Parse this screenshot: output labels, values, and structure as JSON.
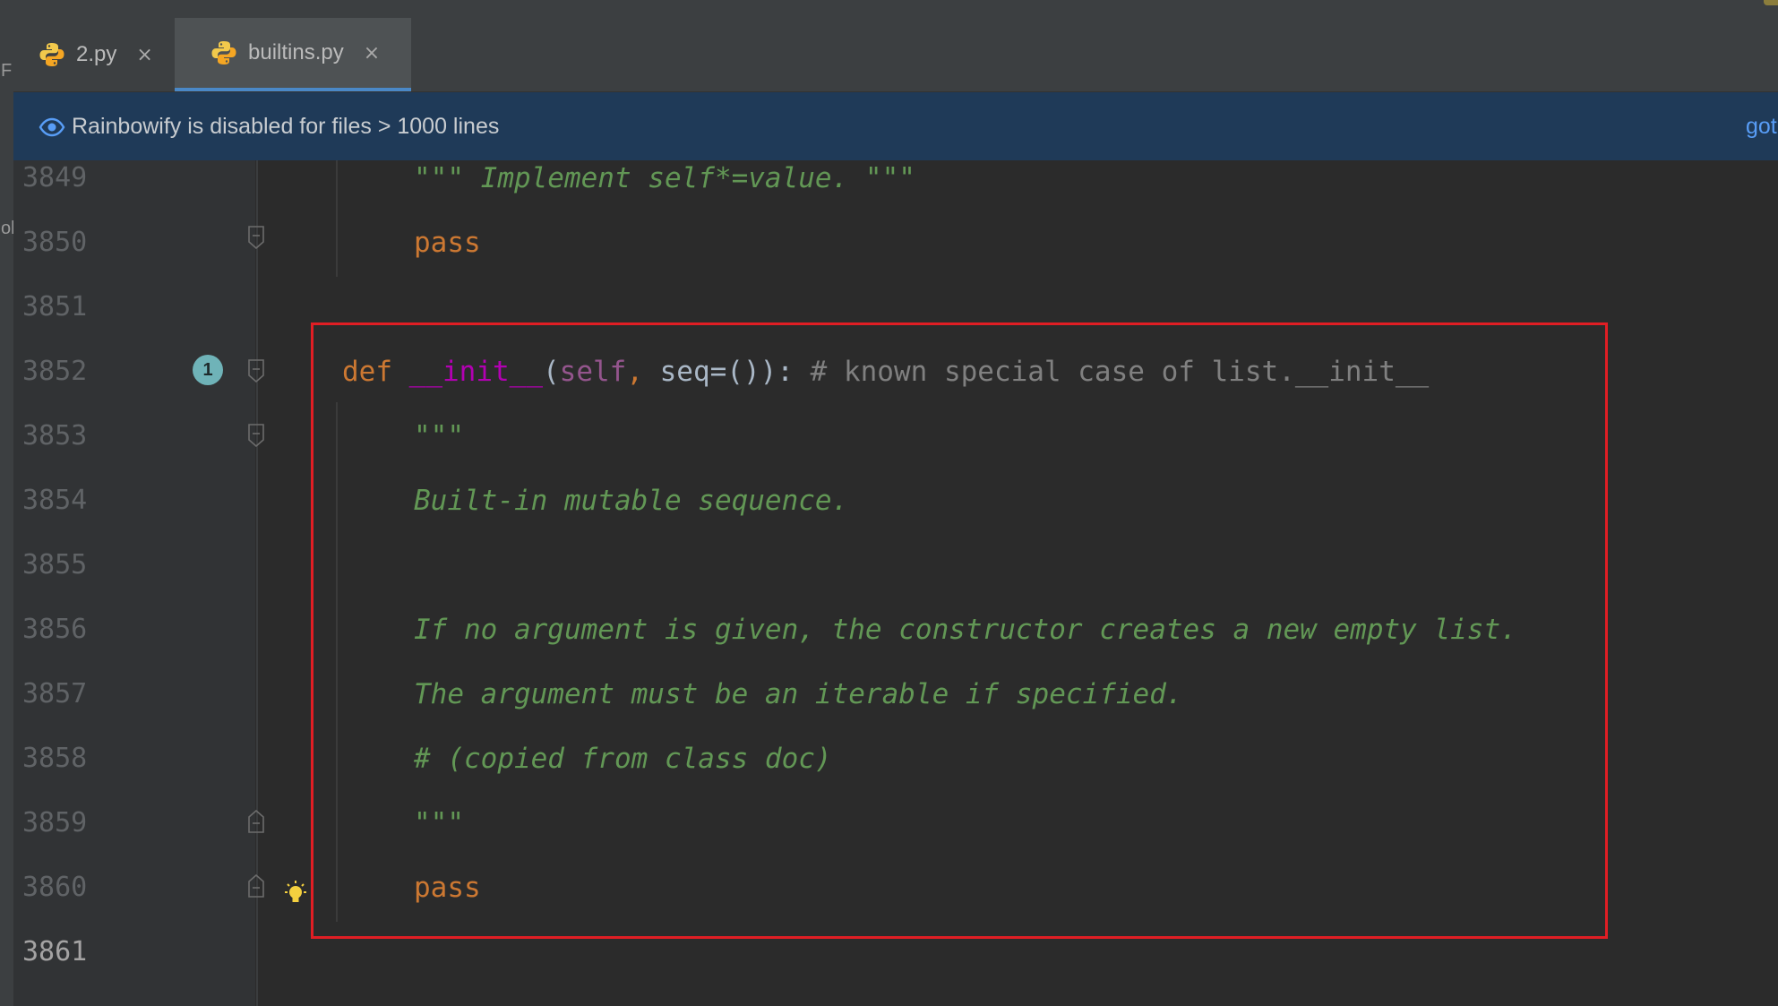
{
  "left_strip": {
    "text_top": "F",
    "text_mid": "ol"
  },
  "tabs": [
    {
      "label": "2.py",
      "icon": "python-icon",
      "active": false,
      "close": "×"
    },
    {
      "label": "builtins.py",
      "icon": "python-icon",
      "active": true,
      "close": "×"
    }
  ],
  "banner": {
    "icon": "eye-icon",
    "text": "Rainbowify is disabled for files > 1000 lines",
    "link": "got"
  },
  "editor": {
    "line_numbers": [
      "3849",
      "3850",
      "3851",
      "3852",
      "3853",
      "3854",
      "3855",
      "3856",
      "3857",
      "3858",
      "3859",
      "3860",
      "3861"
    ],
    "current_line": "3861",
    "lines": {
      "l3849": "\"\"\" Implement self*=value. \"\"\"",
      "l3850": "pass",
      "l3852_def": "def",
      "l3852_name": "__init__",
      "l3852_paren_open": "(",
      "l3852_self": "self",
      "l3852_comma": ",",
      "l3852_rest": " seq=()):",
      "l3852_comment": "# known special case of list.__init__",
      "l3853": "\"\"\"",
      "l3854": "Built-in mutable sequence.",
      "l3856": "If no argument is given, the constructor creates a new empty list.",
      "l3857": "The argument must be an iterable if specified.",
      "l3858": "# (copied from class doc)",
      "l3859": "\"\"\"",
      "l3860": "pass"
    },
    "gutter_badge": "1",
    "gutter_icons": [
      "fold-icon",
      "intention-bulb-icon",
      "override-badge-icon"
    ]
  },
  "colors": {
    "keyword": "#cc7832",
    "function": "#b200b2",
    "self": "#94558d",
    "docstring": "#629755",
    "comment": "#808080",
    "highlight_box": "#e01e24"
  }
}
